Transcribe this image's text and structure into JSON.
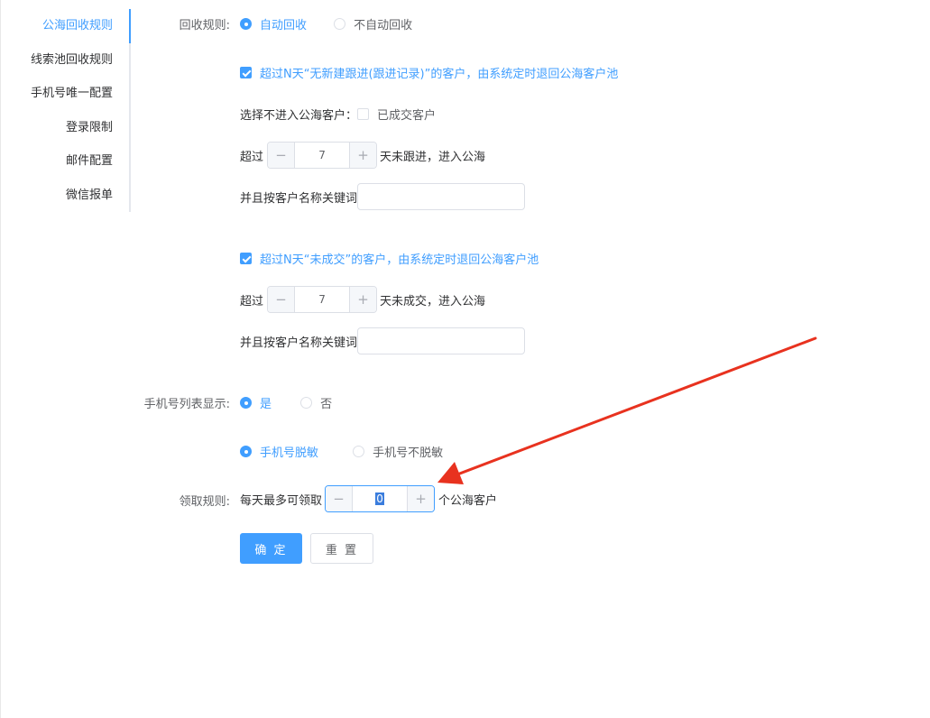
{
  "sidebar": {
    "items": [
      {
        "label": "公海回收规则",
        "active": true
      },
      {
        "label": "线索池回收规则"
      },
      {
        "label": "手机号唯一配置"
      },
      {
        "label": "登录限制"
      },
      {
        "label": "邮件配置"
      },
      {
        "label": "微信报单"
      }
    ]
  },
  "recycle": {
    "label": "回收规则:",
    "options": [
      "自动回收",
      "不自动回收"
    ],
    "rule1": {
      "checkbox_label": "超过N天“无新建跟进(跟进记录)”的客户，由系统定时退回公海客户池",
      "exclude_label": "选择不进入公海客户：",
      "exclude_option": "已成交客户",
      "prefix": "超过",
      "days": "7",
      "suffix": "天未跟进，进入公海",
      "keyword_label": "并且按客户名称关键词",
      "keyword_value": ""
    },
    "rule2": {
      "checkbox_label": "超过N天“未成交”的客户，由系统定时退回公海客户池",
      "prefix": "超过",
      "days": "7",
      "suffix": "天未成交，进入公海",
      "keyword_label": "并且按客户名称关键词",
      "keyword_value": ""
    }
  },
  "phone_display": {
    "label": "手机号列表显示:",
    "options": [
      "是",
      "否"
    ],
    "mask_options": [
      "手机号脱敏",
      "手机号不脱敏"
    ]
  },
  "claim": {
    "label": "领取规则:",
    "prefix": "每天最多可领取",
    "value": "0",
    "suffix": "个公海客户"
  },
  "actions": {
    "confirm": "确 定",
    "reset": "重 置"
  },
  "colors": {
    "primary": "#409eff",
    "annotation_arrow": "#e8321f"
  }
}
